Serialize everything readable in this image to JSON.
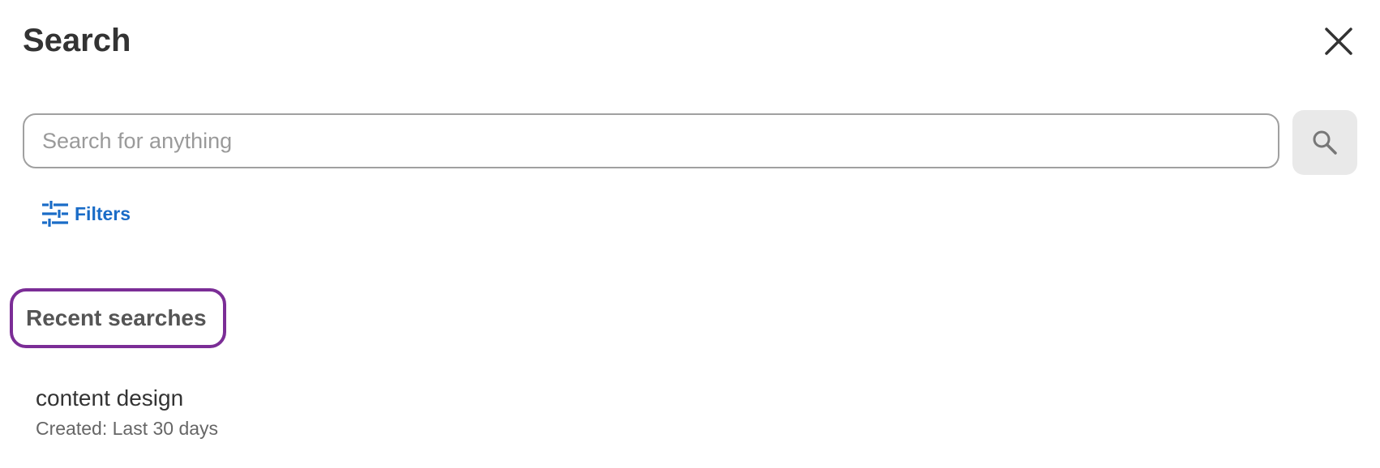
{
  "header": {
    "title": "Search",
    "close_icon": "close-icon"
  },
  "search": {
    "placeholder": "Search for anything",
    "value": "",
    "button_icon": "search-icon"
  },
  "filters": {
    "label": "Filters",
    "icon": "sliders-icon"
  },
  "recent": {
    "heading": "Recent searches",
    "items": [
      {
        "query": "content design",
        "meta": "Created: Last 30 days"
      }
    ]
  },
  "colors": {
    "link": "#1a6cc7",
    "highlight_outline": "#7b2d96",
    "search_button_bg": "#e9e9e9",
    "text": "#333333"
  }
}
